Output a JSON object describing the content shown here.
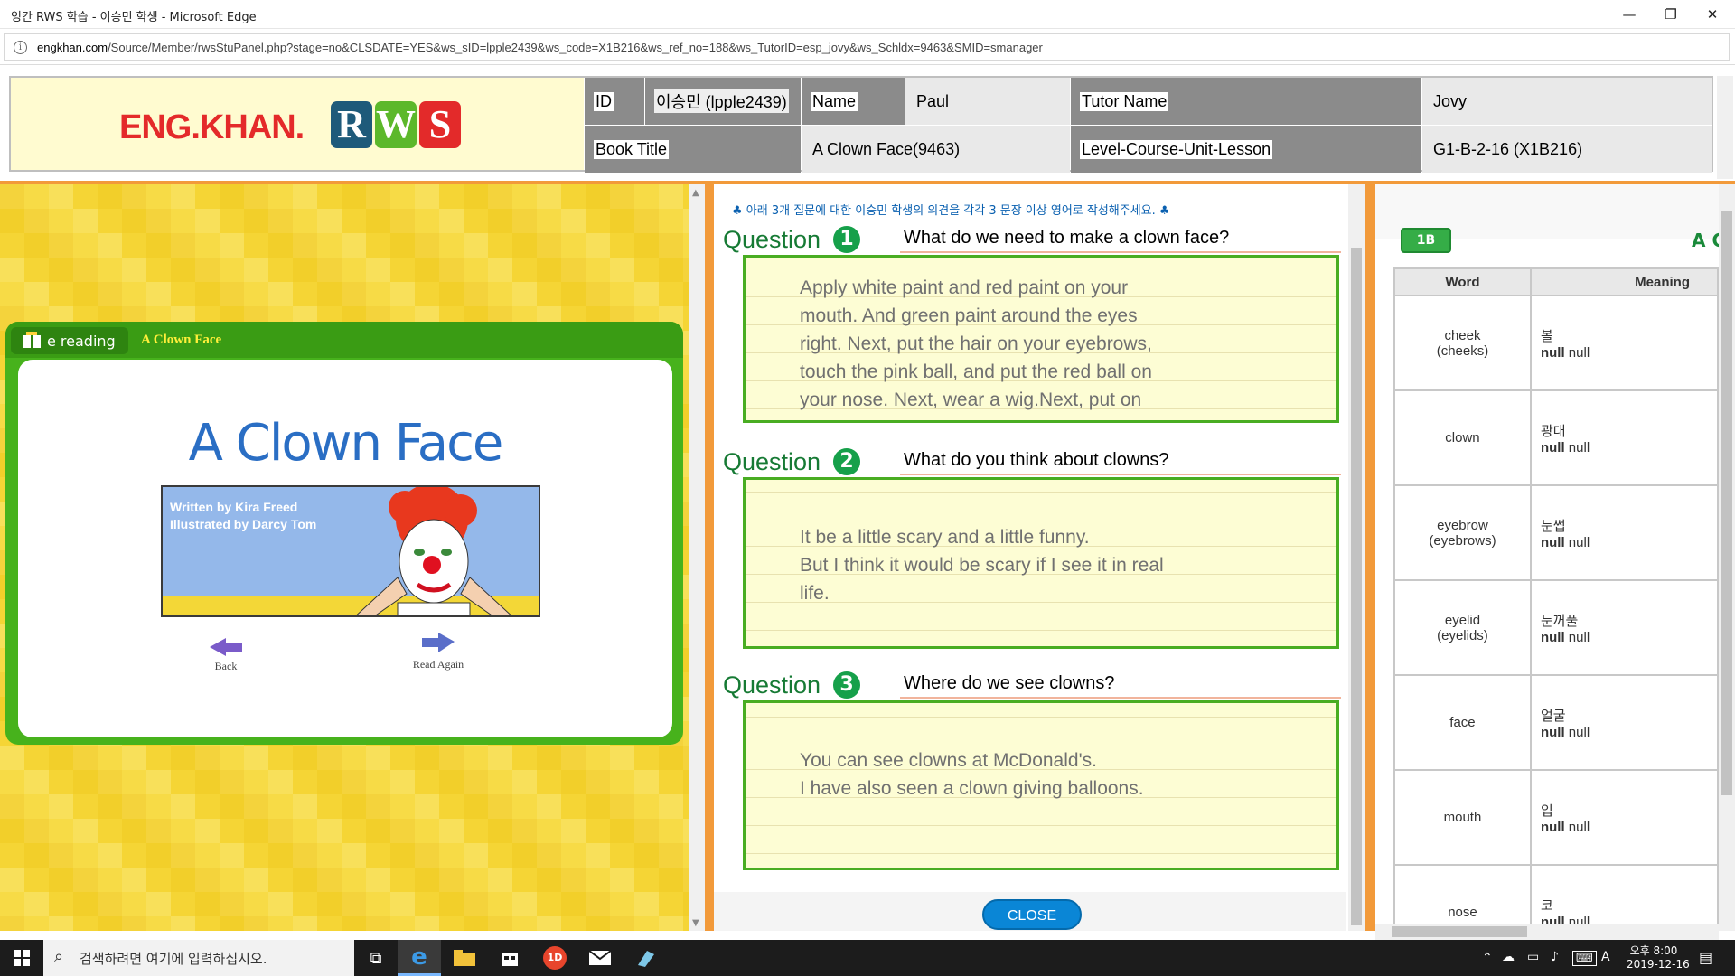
{
  "window": {
    "title": "잉칸 RWS 학습 - 이승민 학생 - Microsoft Edge",
    "minimize_glyph": "—",
    "restore_glyph": "❐",
    "close_glyph": "✕"
  },
  "address": {
    "info_glyph": "i",
    "host": "engkhan.com",
    "path": "/Source/Member/rwsStuPanel.php?stage=no&CLSDATE=YES&ws_sID=lpple2439&ws_code=X1B216&ws_ref_no=188&ws_TutorID=esp_jovy&ws_Schldx=9463&SMID=smanager"
  },
  "header": {
    "logo_text": "ENG.KHAN.",
    "logo_r": "R",
    "logo_w": "W",
    "logo_s": "S",
    "id_label": "ID",
    "id_value": "이승민 (lpple2439)",
    "name_label": "Name",
    "name_value": "Paul",
    "tutor_label": "Tutor Name",
    "tutor_value": "Jovy",
    "book_label": "Book Title",
    "book_value": "A Clown Face(9463)",
    "level_label": "Level-Course-Unit-Lesson",
    "level_value": "G1-B-2-16 (X1B216)"
  },
  "book": {
    "brand": "e reading",
    "header_title": "A Clown Face",
    "cover_title": "A Clown Face",
    "written_by": "Written by Kira Freed",
    "illustrated_by": "Illustrated by Darcy Tom",
    "back_label": "Back",
    "read_again_label": "Read Again"
  },
  "questions": {
    "instruction": "♣ 아래 3개 질문에 대한 이승민 학생의 의견을 각각 3 문장 이상 영어로 작성해주세요. ♣",
    "label": "Question",
    "items": [
      {
        "num": "1",
        "text": "What do we need to make a clown face?",
        "answer": [
          "Apply white paint and red paint on your",
          "mouth. And green paint around the eyes",
          "right. Next, put the hair on your eyebrows,",
          "touch the pink ball, and put the red ball on",
          "your nose. Next, wear a wig.Next, put on"
        ]
      },
      {
        "num": "2",
        "text": "What do you think about clowns?",
        "answer": [
          "It be a little scary and a little funny.",
          "But I think it would be scary if I see it in real",
          "life."
        ]
      },
      {
        "num": "3",
        "text": "Where do we see clowns?",
        "answer": [
          "You can see clowns at McDonald's.",
          "I have also seen a clown giving balloons."
        ]
      }
    ],
    "close_label": "CLOSE"
  },
  "vocab": {
    "badge": "1B",
    "title_partial": "A C",
    "col_word": "Word",
    "col_meaning": "Meaning",
    "rows": [
      {
        "word": "cheek",
        "plural": "(cheeks)",
        "meaning": "볼",
        "n1": "null",
        "n2": "null"
      },
      {
        "word": "clown",
        "plural": "",
        "meaning": "광대",
        "n1": "null",
        "n2": "null"
      },
      {
        "word": "eyebrow",
        "plural": "(eyebrows)",
        "meaning": "눈썹",
        "n1": "null",
        "n2": "null"
      },
      {
        "word": "eyelid",
        "plural": "(eyelids)",
        "meaning": "눈꺼풀",
        "n1": "null",
        "n2": "null"
      },
      {
        "word": "face",
        "plural": "",
        "meaning": "얼굴",
        "n1": "null",
        "n2": "null"
      },
      {
        "word": "mouth",
        "plural": "",
        "meaning": "입",
        "n1": "null",
        "n2": "null"
      },
      {
        "word": "nose",
        "plural": "",
        "meaning": "코",
        "n1": "null",
        "n2": "null"
      }
    ]
  },
  "taskbar": {
    "search_placeholder": "검색하려면 여기에 입력하십시오.",
    "time_ampm": "오후 8:00",
    "date": "2019-12-16",
    "ime": "A",
    "app_badge": "1D"
  }
}
